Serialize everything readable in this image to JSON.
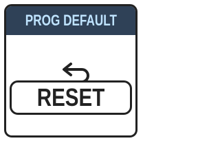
{
  "header": {
    "title": "PROG DEFAULT"
  },
  "reset_button": {
    "label": "RESET",
    "icon": "undo-icon"
  },
  "colors": {
    "header_bg": "#2f4157",
    "header_text": "#bfe3ff",
    "border": "#222222",
    "background": "#ffffff"
  }
}
